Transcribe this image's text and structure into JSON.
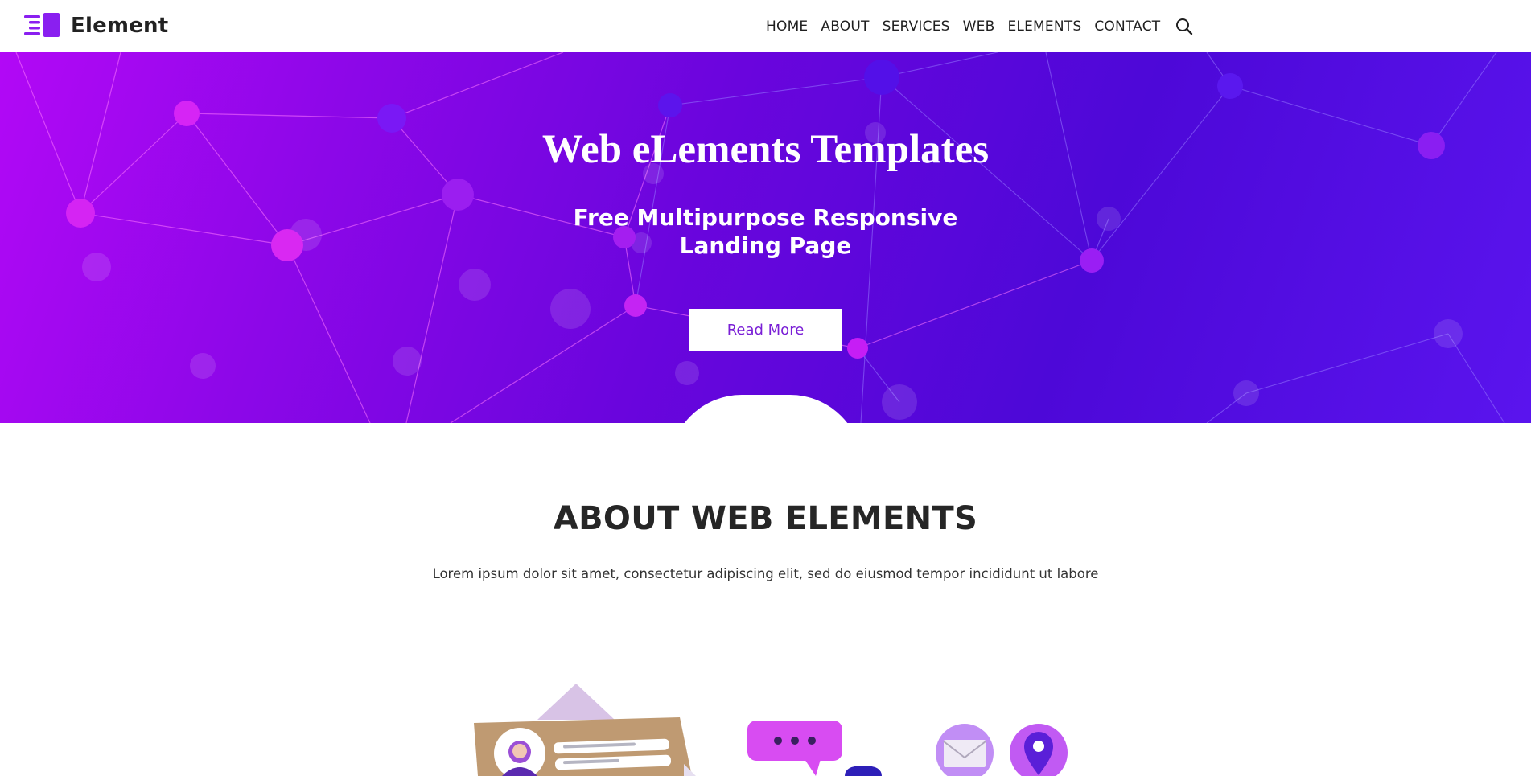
{
  "brand": {
    "name": "Element"
  },
  "nav": {
    "items": [
      "HOME",
      "ABOUT",
      "SERVICES",
      "WEB",
      "ELEMENTS",
      "CONTACT"
    ]
  },
  "hero": {
    "title": "Web eLements Templates",
    "subtitle_line1": "Free Multipurpose Responsive",
    "subtitle_line2": "Landing Page",
    "button_label": "Read More"
  },
  "about": {
    "title": "ABOUT WEB ELEMENTS",
    "text": "Lorem ipsum dolor sit amet, consectetur adipiscing elit, sed do eiusmod tempor incididunt ut labore"
  },
  "colors": {
    "accent": "#8a1ff0",
    "hero_start": "#b208f6",
    "hero_end": "#4d08d8",
    "text_dark": "#222222"
  },
  "icons": [
    "logo-icon",
    "search-icon",
    "profile-card-illustration",
    "chat-bubble-icon",
    "mail-icon",
    "location-pin-icon"
  ]
}
